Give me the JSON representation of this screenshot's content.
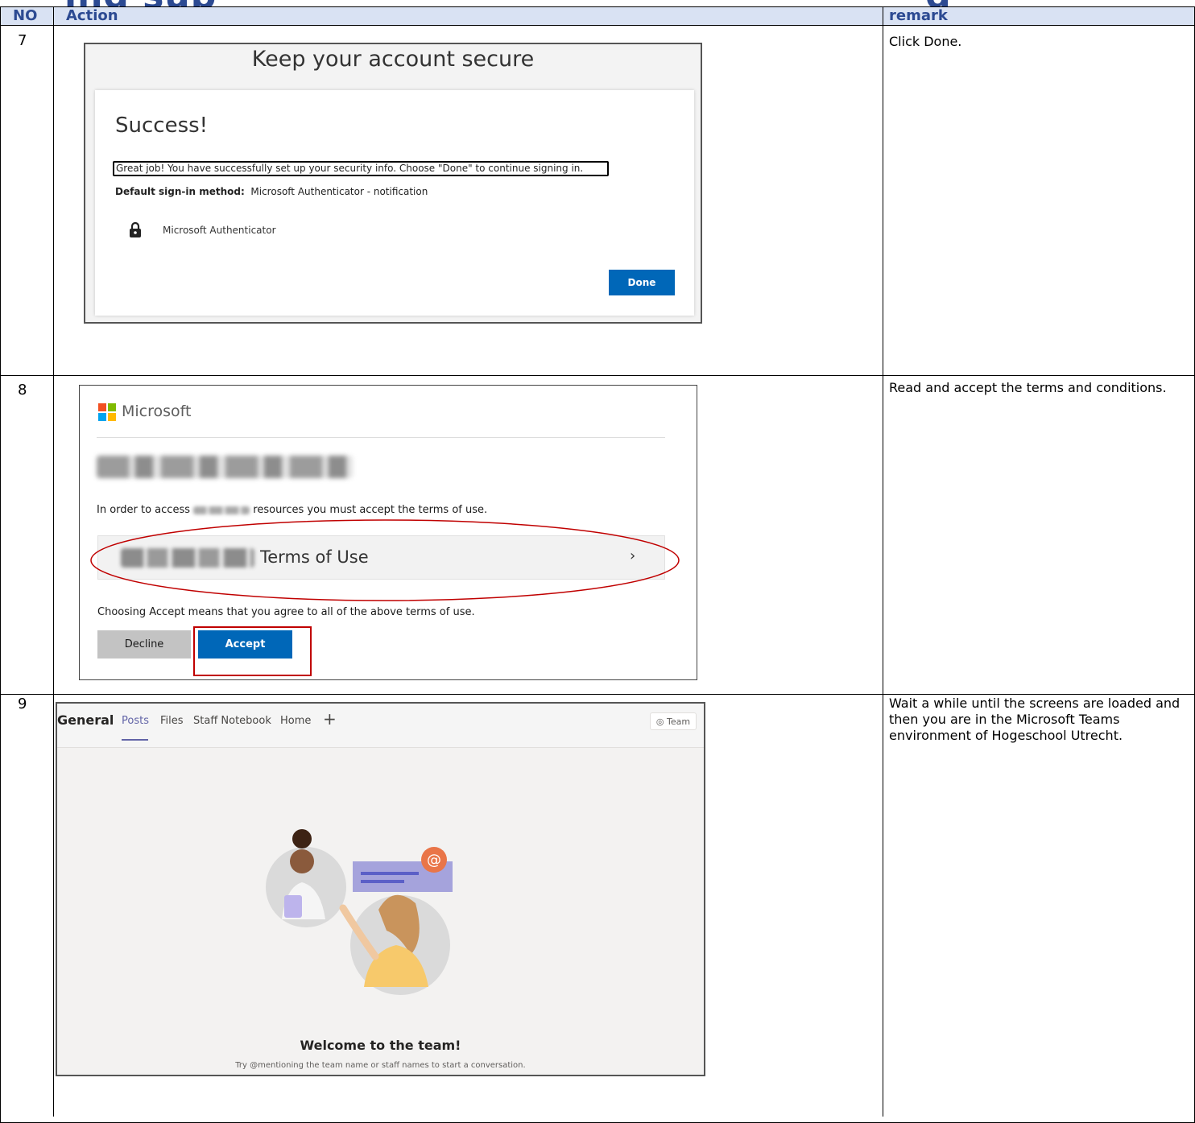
{
  "document": {
    "title_partial": "ing sup",
    "title_partial_right": "g",
    "headers": {
      "no": "NO",
      "action": "Action",
      "remark": "remark"
    }
  },
  "steps": [
    {
      "no": "7",
      "remark": "Click Done."
    },
    {
      "no": "8",
      "remark": "Read and accept the terms and conditions."
    },
    {
      "no": "9",
      "remark": "Wait a while until the screens are loaded and then you are in the Microsoft Teams environment of Hogeschool Utrecht."
    }
  ],
  "step7": {
    "title": "Keep your account secure",
    "success": "Success!",
    "message": "Great job! You have successfully set up your security info. Choose \"Done\" to continue signing in.",
    "default_label": "Default sign-in method:",
    "default_value": "Microsoft Authenticator - notification",
    "method_icon": "lock-icon",
    "method_name": "Microsoft Authenticator",
    "done_button": "Done"
  },
  "step8": {
    "brand": "Microsoft",
    "access_prefix": "In order to access",
    "access_suffix": "resources you must accept the terms of use.",
    "terms_link": "Terms of Use",
    "chevron": "›",
    "agree_text": "Choosing Accept means that you agree to all of the above terms of use.",
    "decline_button": "Decline",
    "accept_button": "Accept",
    "colors": {
      "blue": "#0067b8",
      "red_annotation": "#c00000"
    }
  },
  "step9": {
    "channel": "General",
    "tabs": [
      "Posts",
      "Files",
      "Staff Notebook",
      "Home"
    ],
    "add_tab": "+",
    "team_button": "◎ Team",
    "welcome": "Welcome to the team!",
    "hint": "Try @mentioning the team name or staff names to start a conversation.",
    "accent": "#6264a7"
  }
}
